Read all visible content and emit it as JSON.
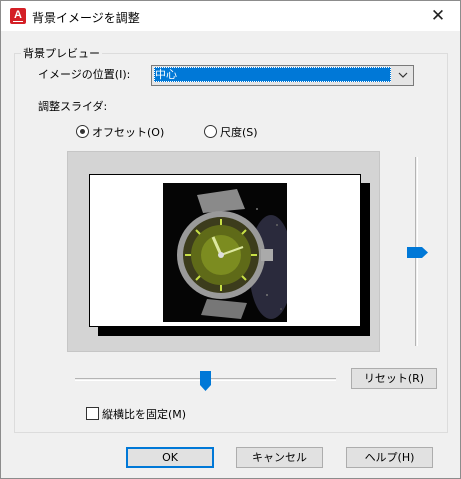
{
  "window": {
    "title": "背景イメージを調整",
    "app_icon_letter": "A",
    "close_glyph": "✕"
  },
  "preview_group": {
    "label": "背景プレビュー"
  },
  "image_position": {
    "label": "イメージの位置(I):",
    "selected_value": "中心"
  },
  "adjust_slider": {
    "label": "調整スライダ:"
  },
  "radios": {
    "offset": {
      "label": "オフセット(O)",
      "checked": true
    },
    "scale": {
      "label": "尺度(S)",
      "checked": false
    }
  },
  "buttons": {
    "reset": "リセット(R)",
    "ok": "OK",
    "cancel": "キャンセル",
    "help": "ヘルプ(H)"
  },
  "lock_aspect": {
    "label": "縦横比を固定(M)",
    "checked": false
  },
  "colors": {
    "accent": "#0078d7",
    "app_icon": "#d41f26"
  },
  "icons": {
    "close": "close-icon",
    "app": "autocad-app-icon",
    "dropdown": "chevron-down-icon",
    "vertical_thumb": "arrow-right-thumb-icon",
    "horizontal_thumb": "arrow-down-thumb-icon"
  }
}
